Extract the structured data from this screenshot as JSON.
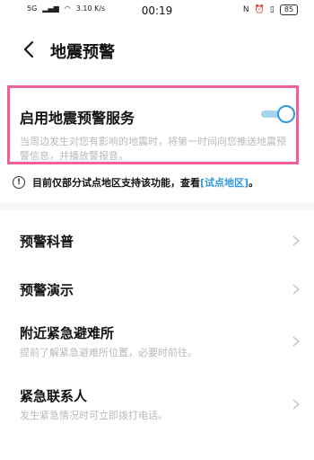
{
  "status_bar": {
    "network": "5G",
    "speed": "3.10 K/s",
    "time": "00:19",
    "battery": "85"
  },
  "header": {
    "title": "地震预警"
  },
  "service": {
    "label": "启用地震预警服务",
    "enabled": true,
    "description": "当周边发生对您有影响的地震时，将第一时间向您推送地震预警信息，并播放警报音。"
  },
  "notice": {
    "text": "目前仅部分试点地区支持该功能，查看",
    "link": "[试点地区]",
    "end": "。"
  },
  "menu": {
    "items": [
      {
        "label": "预警科普",
        "sub": ""
      },
      {
        "label": "预警演示",
        "sub": ""
      },
      {
        "label": "附近紧急避难所",
        "sub": "提前了解紧急避难所位置，必要时前往。"
      },
      {
        "label": "紧急联系人",
        "sub": "发生紧急情况时可立即拨打电话。"
      }
    ]
  },
  "colors": {
    "accent": "#2f9ae0",
    "highlight_border": "#f0609b",
    "secondary_text": "#b9b9b9"
  }
}
